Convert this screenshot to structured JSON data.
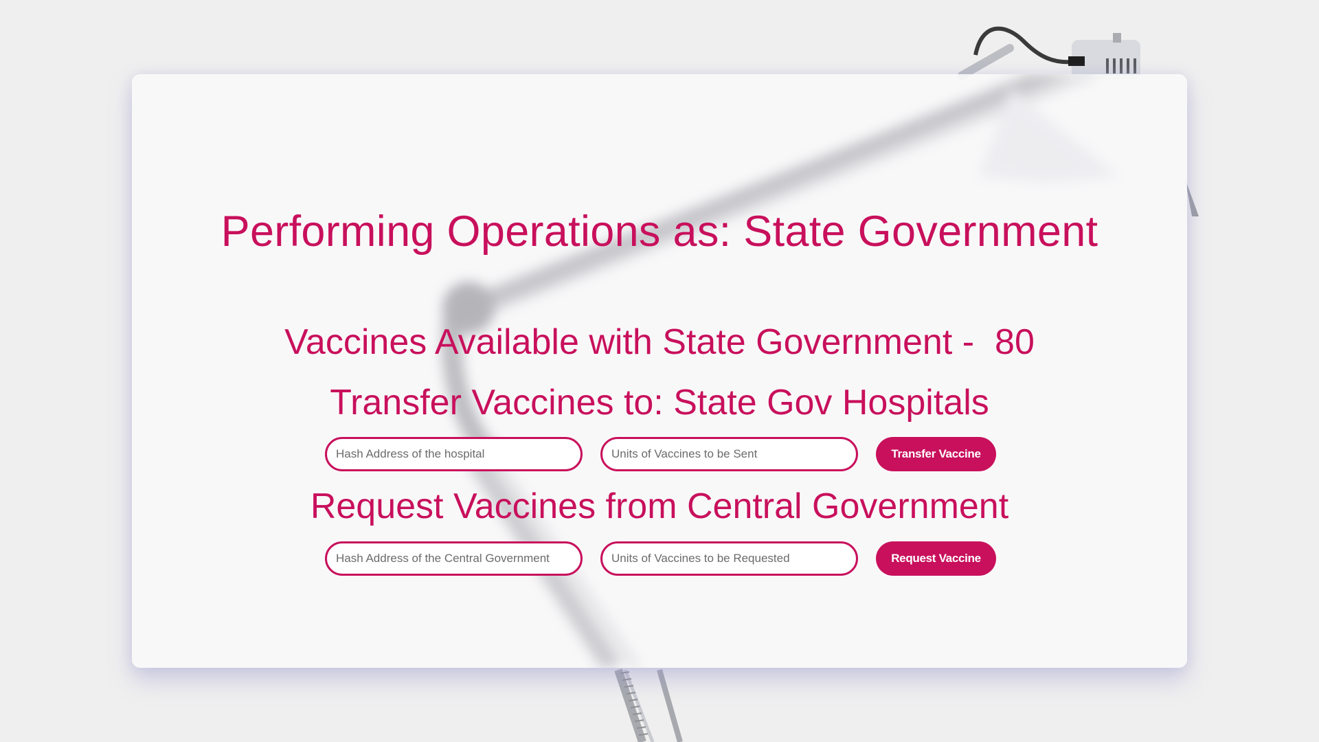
{
  "page": {
    "title_prefix": "Performing Operations as:",
    "role": "State Government",
    "accent_color": "#c8105c"
  },
  "inventory": {
    "label": "Vaccines Available with State Government -",
    "count": "80"
  },
  "transfer": {
    "heading": "Transfer Vaccines to: State Gov Hospitals",
    "hash_placeholder": "Hash Address of the hospital",
    "units_placeholder": "Units of Vaccines to be Sent",
    "button_label": "Transfer Vaccine"
  },
  "request": {
    "heading": "Request Vaccines from Central Government",
    "hash_placeholder": "Hash Address of the Central Government",
    "units_placeholder": "Units of Vaccines to be Requested",
    "button_label": "Request Vaccine"
  },
  "background": {
    "image": "desk-lamp-photo"
  }
}
